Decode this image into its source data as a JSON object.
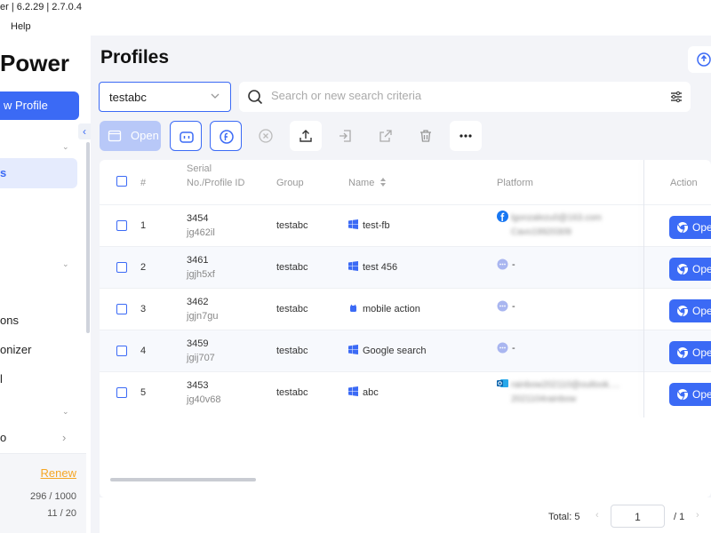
{
  "titlebar": {
    "title": "er | 6.2.29 | 2.7.0.4"
  },
  "menubar": {
    "items": [
      "Help"
    ]
  },
  "sidebar": {
    "brand": "Power",
    "new_profile": "w Profile",
    "active_item": "s",
    "items": [
      "ons",
      "onizer",
      "l",
      "o"
    ],
    "renew": "Renew",
    "quota_profiles": "296 / 1000",
    "quota_members": "11 / 20"
  },
  "main": {
    "title": "Profiles",
    "group_select": "testabc",
    "search_placeholder": "Search or new search criteria",
    "open_label": "Open"
  },
  "table": {
    "headers": {
      "index": "#",
      "serial": "Serial No./Profile ID",
      "group": "Group",
      "name": "Name",
      "platform": "Platform",
      "action": "Action"
    },
    "action_label": "Open",
    "rows": [
      {
        "index": "1",
        "serial": "3454",
        "profile_id": "jg462il",
        "group": "testabc",
        "name": "test-fb",
        "os": "windows",
        "platform_icon": "facebook",
        "platform_line1": "lgonzalezu0@163.com",
        "platform_line2": "Cavo19920309"
      },
      {
        "index": "2",
        "serial": "3461",
        "profile_id": "jgjh5xf",
        "group": "testabc",
        "name": "test 456",
        "os": "windows",
        "platform_icon": "other",
        "platform_line1": "-",
        "platform_line2": ""
      },
      {
        "index": "3",
        "serial": "3462",
        "profile_id": "jgjn7gu",
        "group": "testabc",
        "name": "mobile action",
        "os": "android",
        "platform_icon": "other",
        "platform_line1": "-",
        "platform_line2": ""
      },
      {
        "index": "4",
        "serial": "3459",
        "profile_id": "jgij707",
        "group": "testabc",
        "name": "Google search",
        "os": "windows",
        "platform_icon": "other",
        "platform_line1": "-",
        "platform_line2": ""
      },
      {
        "index": "5",
        "serial": "3453",
        "profile_id": "jg40v68",
        "group": "testabc",
        "name": "abc",
        "os": "windows",
        "platform_icon": "outlook",
        "platform_line1": "rainbow202110@outlook.…",
        "platform_line2": "2021104rainbow"
      }
    ]
  },
  "pagination": {
    "total": "Total: 5",
    "page": "1",
    "of": "/ 1"
  },
  "colors": {
    "accent": "#3b6af5",
    "renew": "#f5a623"
  }
}
